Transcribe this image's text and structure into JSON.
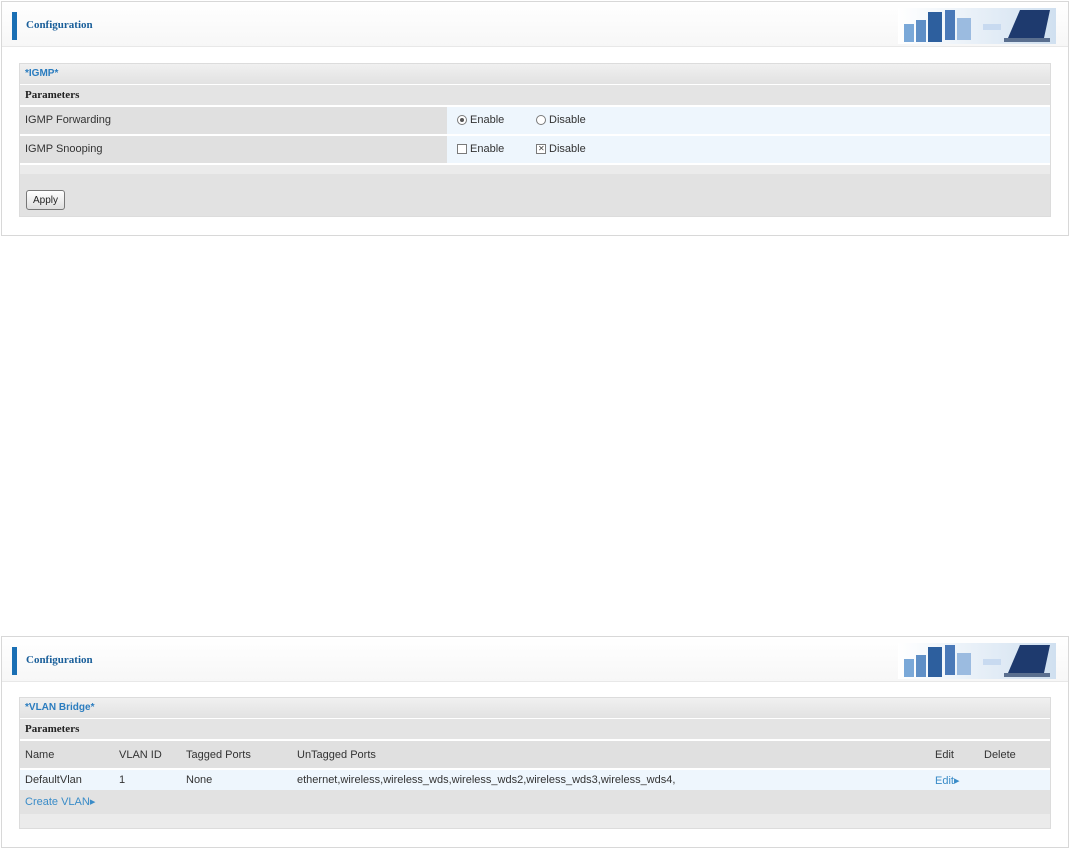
{
  "panel1": {
    "header_title": "Configuration",
    "section_title": "IGMP",
    "sub_title": "Parameters",
    "rows": [
      {
        "label": "IGMP Forwarding",
        "option1": "Enable",
        "option2": "Disable",
        "selected": "Enable"
      },
      {
        "label": "IGMP Snooping",
        "option1": "Enable",
        "option2": "Disable",
        "selected": "Disable"
      }
    ],
    "apply_label": "Apply"
  },
  "panel2": {
    "header_title": "Configuration",
    "section_title": "VLAN Bridge",
    "sub_title": "Parameters",
    "columns": [
      "Name",
      "VLAN ID",
      "Tagged Ports",
      "UnTagged Ports",
      "Edit",
      "Delete"
    ],
    "rows": [
      {
        "name": "DefaultVlan",
        "vlan_id": "1",
        "tagged": "None",
        "untagged": "ethernet,wireless,wireless_wds,wireless_wds2,wireless_wds3,wireless_wds4,",
        "edit": "Edit",
        "delete": ""
      }
    ],
    "create_link": "Create VLAN"
  },
  "colors": {
    "accent": "#1a6fb4",
    "link": "#3a8cc8",
    "section_bg": "#ebebeb",
    "value_bg": "#eef6fd"
  }
}
